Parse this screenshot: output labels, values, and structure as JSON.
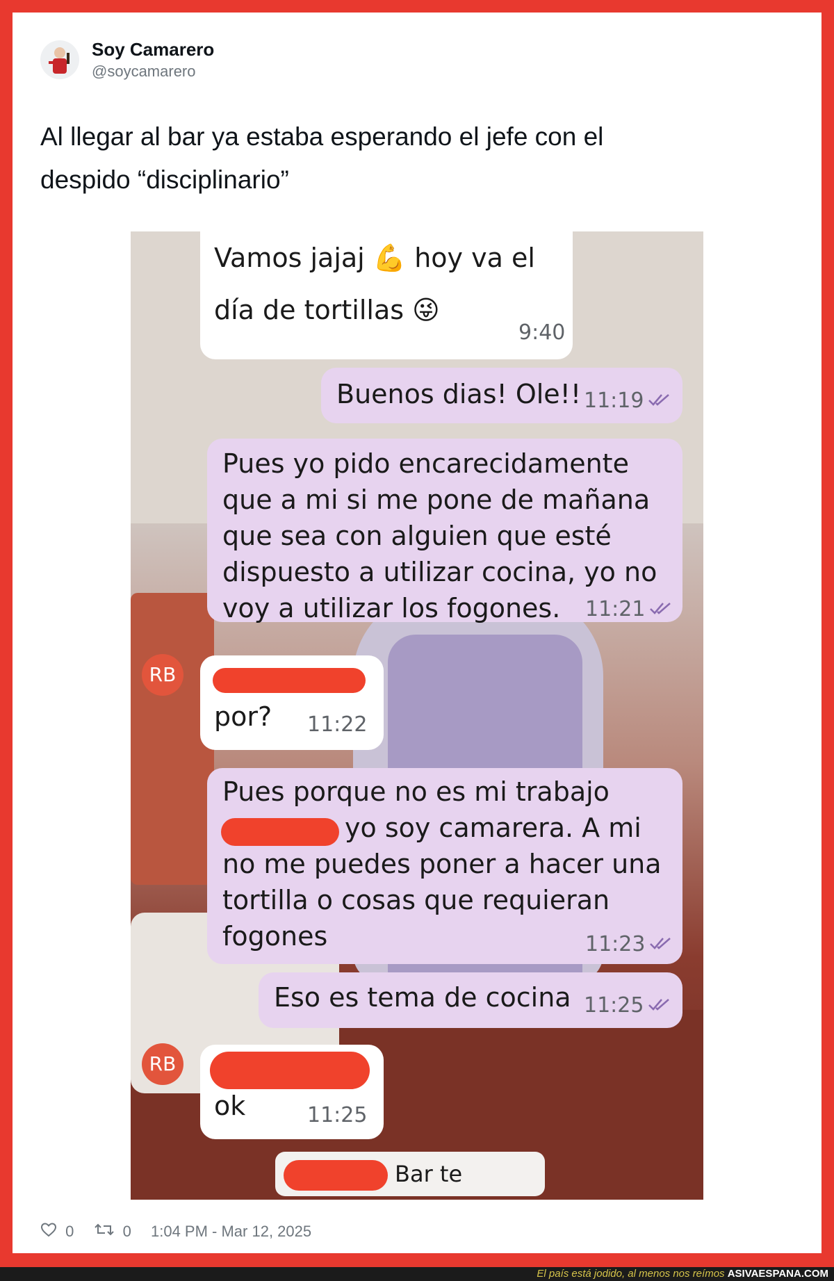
{
  "tweet": {
    "user_name": "Soy Camarero",
    "user_handle": "@soycamarero",
    "text_line1": "Al llegar al bar ya estaba esperando el jefe con el",
    "text_line2": "despido “disciplinario”",
    "likes": "0",
    "retweets": "0",
    "timestamp": "1:04 PM - Mar 12, 2025"
  },
  "chat": {
    "messages": [
      {
        "sender": "in",
        "lines": [
          "Vamos jajaj 💪 hoy va el",
          "día de tortillas 😜"
        ],
        "time": "9:40"
      },
      {
        "sender": "out",
        "lines": [
          "Buenos dias! Ole!!"
        ],
        "time": "11:19"
      },
      {
        "sender": "out",
        "lines": [
          "Pues yo pido encarecidamente",
          "que a mi si me pone de mañana",
          "que sea con alguien que esté",
          "dispuesto a utilizar cocina, yo no",
          "voy a utilizar los fogones."
        ],
        "time": "11:21"
      },
      {
        "sender": "in",
        "lines": [
          "por?"
        ],
        "time": "11:22"
      },
      {
        "sender": "out",
        "lines": [
          "Pues porque no es mi trabajo",
          "yo soy camarera. A mi",
          "no me puedes poner a hacer una",
          "tortilla o cosas que requieran",
          "fogones"
        ],
        "time": "11:23"
      },
      {
        "sender": "out",
        "lines": [
          "Eso es tema de cocina"
        ],
        "time": "11:25"
      },
      {
        "sender": "in",
        "lines": [
          "ok"
        ],
        "time": "11:25"
      }
    ],
    "avatar_initials": "RB",
    "system_notice": "Bar te eliminó."
  },
  "watermark": {
    "tagline": "El país está jodido, al menos nos reímos",
    "site": "ASIVAESPANA.COM"
  },
  "colors": {
    "border": "#e8392f",
    "outgoing_bubble": "#e7d3ef",
    "incoming_bubble": "#ffffff",
    "avatar": "#e2553c",
    "redaction": "#f0422c"
  }
}
